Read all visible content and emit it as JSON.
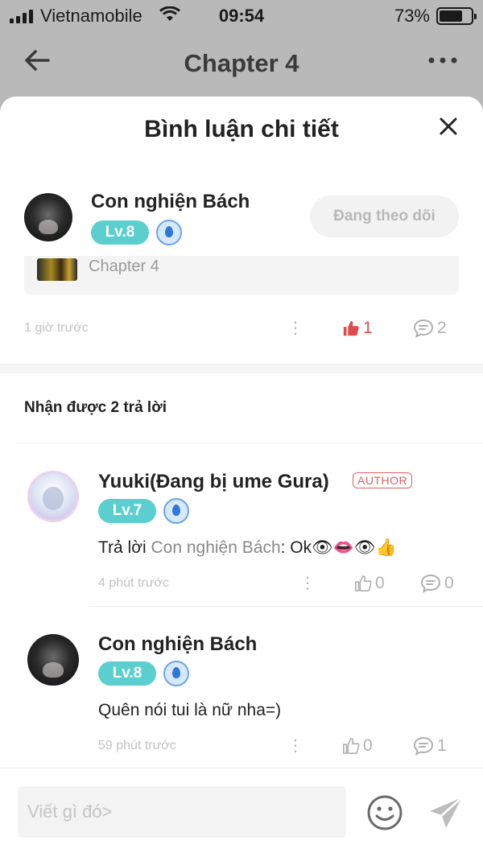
{
  "status_bar": {
    "carrier": "Vietnamobile",
    "time": "09:54",
    "battery": "73%",
    "battery_level": 0.73
  },
  "nav": {
    "title": "Chapter 4"
  },
  "sheet": {
    "title": "Bình luận chi tiết"
  },
  "main_comment": {
    "username": "Con nghiện Bách",
    "level": "Lv.8",
    "follow_label": "Đang theo dõi",
    "chapter_label": "Chapter 4",
    "time": "1 giờ trước",
    "likes": "1",
    "comments": "2"
  },
  "replies_header": "Nhận được 2 trả lời",
  "replies": [
    {
      "username": "Yuuki(Đang bị ume Gura)",
      "tag": "AUTHOR",
      "level": "Lv.7",
      "prefix": "Trả lời ",
      "mention": "Con nghiện Bách",
      "text": ": Ok👁👄👁👍",
      "time": "4 phút trước",
      "likes": "0",
      "comments": "0"
    },
    {
      "username": "Con nghiện Bách",
      "level": "Lv.8",
      "text": "Quên nói tui là nữ nha=)",
      "time": "59 phút trước",
      "likes": "0",
      "comments": "1"
    }
  ],
  "input": {
    "placeholder": "Viết gì đó>"
  },
  "colors": {
    "level": "#5bcfcf",
    "liked": "#e04b4b",
    "author_tag": "#e06060"
  },
  "icons": [
    "back-arrow-icon",
    "more-icon",
    "close-icon",
    "thumbs-up-icon",
    "comment-icon",
    "emoji-icon",
    "send-icon",
    "wifi-icon",
    "signal-icon",
    "battery-icon",
    "diamond-badge-icon"
  ]
}
